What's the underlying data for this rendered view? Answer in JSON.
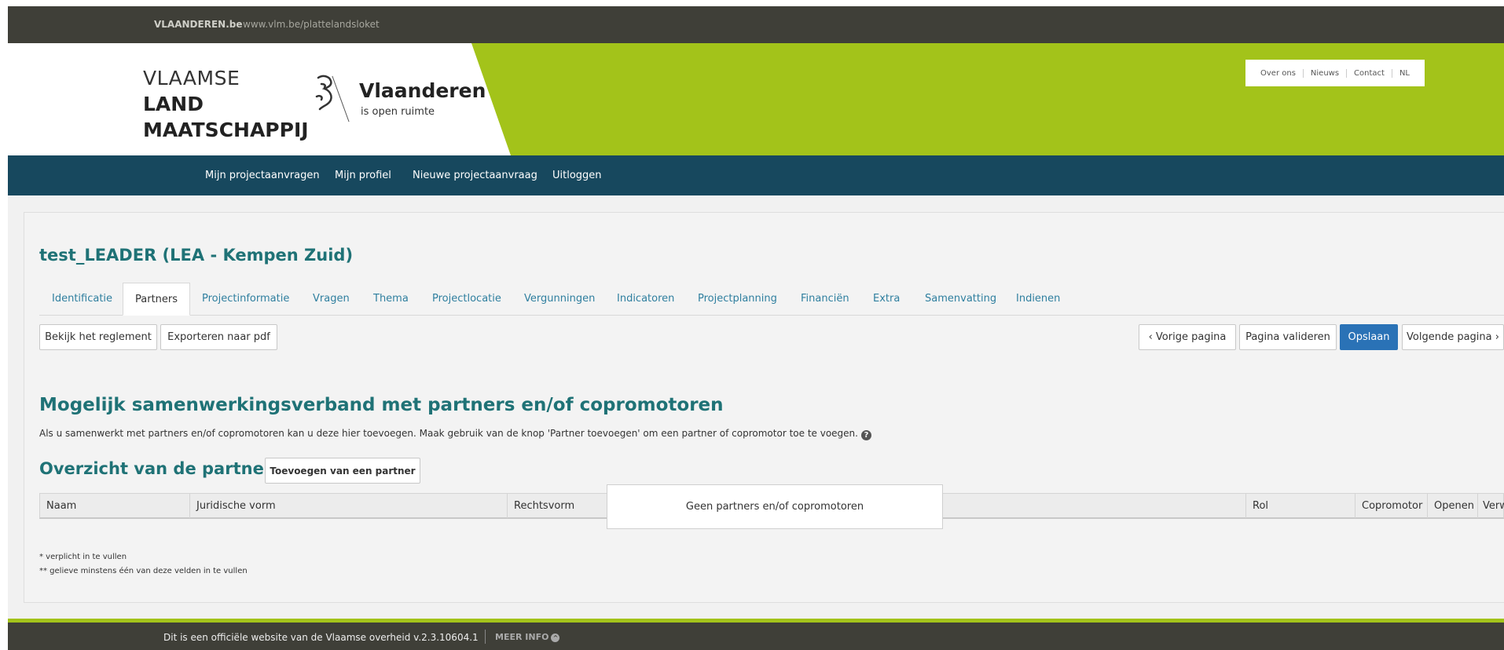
{
  "topbar": {
    "brand": "VLAANDEREN.be",
    "url": "www.vlm.be/plattelandsloket"
  },
  "vlm_logo": {
    "line1": "VLAAMSE",
    "line2": "LAND",
    "line3": "MAATSCHAPPIJ"
  },
  "vl_logo": {
    "title": "Vlaanderen",
    "subtitle": "is open ruimte"
  },
  "util_nav": [
    "Over ons",
    "Nieuws",
    "Contact",
    "NL"
  ],
  "main_nav": [
    "Mijn projectaanvragen",
    "Mijn profiel",
    "Nieuwe projectaanvraag",
    "Uitloggen"
  ],
  "page_title": "test_LEADER (LEA - Kempen Zuid)",
  "tabs": [
    "Identificatie",
    "Partners",
    "Projectinformatie",
    "Vragen",
    "Thema",
    "Projectlocatie",
    "Vergunningen",
    "Indicatoren",
    "Projectplanning",
    "Financiën",
    "Extra",
    "Samenvatting",
    "Indienen"
  ],
  "active_tab": "Partners",
  "toolbar": {
    "reglement": "Bekijk het reglement",
    "export_pdf": "Exporteren naar pdf",
    "prev": "‹ Vorige pagina",
    "validate": "Pagina valideren",
    "save": "Opslaan",
    "next": "Volgende pagina ›"
  },
  "section": {
    "title": "Mogelijk samenwerkingsverband met partners en/of copromotoren",
    "description": "Als u samenwerkt met partners en/of copromotoren kan u deze hier toevoegen. Maak gebruik van de knop 'Partner toevoegen' om een partner of copromotor toe te voegen."
  },
  "overview": {
    "title": "Overzicht van de partners",
    "add_button": "Toevoegen van een partner"
  },
  "table": {
    "columns": [
      "Naam",
      "Juridische vorm",
      "Rechtsvorm",
      "",
      "Rol",
      "Copromotor",
      "Openen",
      "Verwijderen"
    ],
    "empty_message": "Geen partners en/of copromotoren"
  },
  "notes": [
    "* verplicht in te vullen",
    "** gelieve minstens één van deze velden in te vullen"
  ],
  "footer": {
    "text": "Dit is een officiële website van de Vlaamse overheid v.2.3.10604.1",
    "more": "MEER INFO"
  },
  "colors": {
    "green": "#a3c31a",
    "navy": "#17485e",
    "teal": "#1f7276",
    "primary": "#2a72b6",
    "dark": "#3f3f38"
  }
}
